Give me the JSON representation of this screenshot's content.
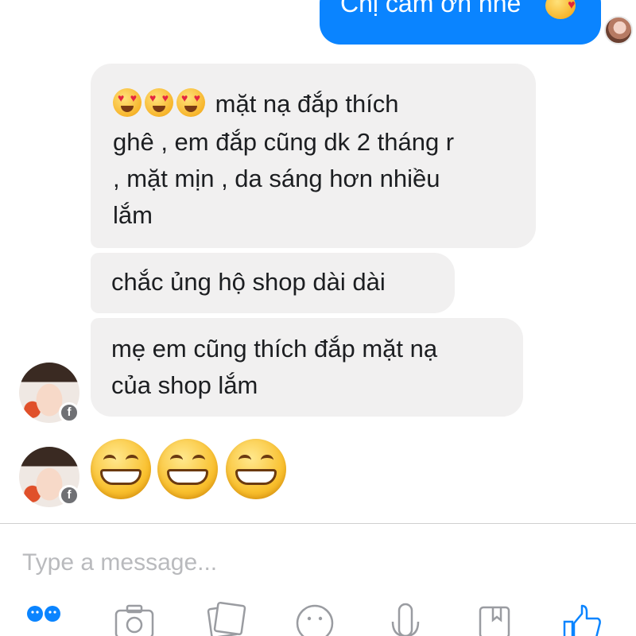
{
  "outgoing": {
    "text": "Chị cảm ơn nhé"
  },
  "messages": [
    {
      "lines": [
        "mặt nạ đắp thích",
        "ghê , em đắp cũng dk 2 tháng r",
        ", mặt mịn , da sáng hơn nhiều",
        "lắm"
      ],
      "leading_emoji": "heart-eyes"
    },
    {
      "lines": [
        "chắc ủng hộ shop dài dài"
      ]
    },
    {
      "lines": [
        "mẹ em cũng  thích đắp mặt nạ",
        "của shop lắm"
      ]
    }
  ],
  "reaction": {
    "emoji": "grinning-face",
    "count": 3
  },
  "composer": {
    "placeholder": "Type a message..."
  },
  "toolbar": {
    "icons": [
      "emoji-icon",
      "camera-icon",
      "gallery-icon",
      "smiley-icon",
      "microphone-icon",
      "sticker-icon",
      "like-icon"
    ]
  },
  "colors": {
    "outgoing_bubble": "#0a84ff",
    "incoming_bubble": "#f1f0f0",
    "accent": "#0a84ff"
  }
}
